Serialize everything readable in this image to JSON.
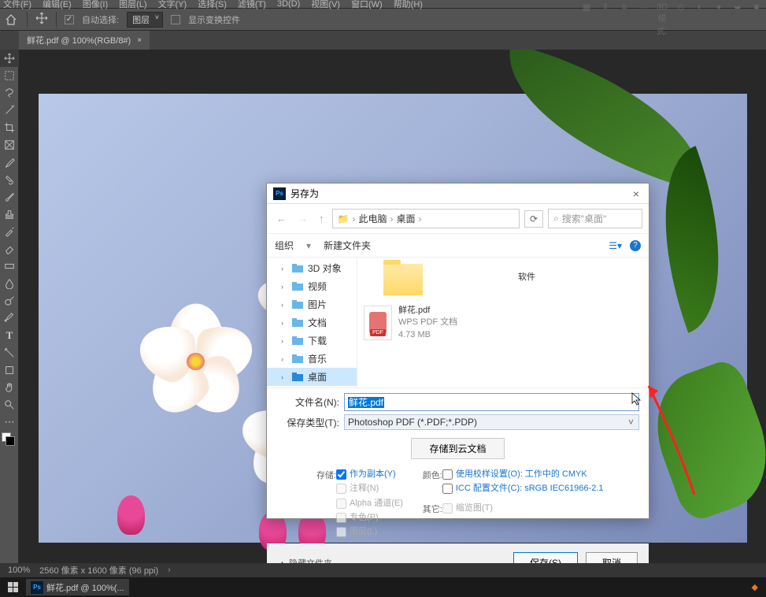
{
  "menu": {
    "file": "文件(F)",
    "edit": "编辑(E)",
    "image": "图像(I)",
    "layer": "图层(L)",
    "type": "文字(Y)",
    "select": "选择(S)",
    "filter": "滤镜(T)",
    "threed": "3D(D)",
    "view": "视图(V)",
    "window": "窗口(W)",
    "help": "帮助(H)"
  },
  "options": {
    "autoselect": "自动选择:",
    "layer": "图层",
    "showcontrols": "显示变换控件",
    "threed_mode": "3D 模式:"
  },
  "doc_tab": {
    "title": "鲜花.pdf @ 100%(RGB/8#)"
  },
  "dialog": {
    "title": "另存为",
    "breadcrumb": {
      "pc": "此电脑",
      "desktop": "桌面"
    },
    "search_placeholder": "搜索\"桌面\"",
    "toolbar": {
      "organize": "组织",
      "newfolder": "新建文件夹"
    },
    "sidebar": {
      "d3": "3D 对象",
      "video": "视频",
      "pictures": "图片",
      "documents": "文档",
      "downloads": "下载",
      "music": "音乐",
      "desktop": "桌面"
    },
    "content": {
      "folder_name": "软件",
      "pdf": {
        "name": "鲜花.pdf",
        "type": "WPS PDF 文档",
        "size": "4.73 MB"
      }
    },
    "fields": {
      "filename_label": "文件名(N):",
      "filename_value": "鲜花.pdf",
      "filetype_label": "保存类型(T):",
      "filetype_value": "Photoshop PDF (*.PDF;*.PDP)"
    },
    "cloud_btn": "存储到云文档",
    "store_label": "存储:",
    "opt_copy": "作为副本(Y)",
    "opt_annot": "注释(N)",
    "opt_alpha": "Alpha 通道(E)",
    "opt_spot": "专色(P)",
    "opt_layers": "图层(L)",
    "color_label": "颜色:",
    "opt_proof": "使用校样设置(O): 工作中的 CMYK",
    "opt_icc": "ICC 配置文件(C): sRGB IEC61966-2.1",
    "other_label": "其它:",
    "opt_thumb": "缩览图(T)",
    "hide_folders": "▲ 隐藏文件夹",
    "save_btn": "保存(S)",
    "cancel_btn": "取消"
  },
  "status": {
    "zoom": "100%",
    "dims": "2560 像素 x 1600 像素 (96 ppi)"
  },
  "taskbar": {
    "ps_title": "鲜花.pdf @ 100%(..."
  }
}
